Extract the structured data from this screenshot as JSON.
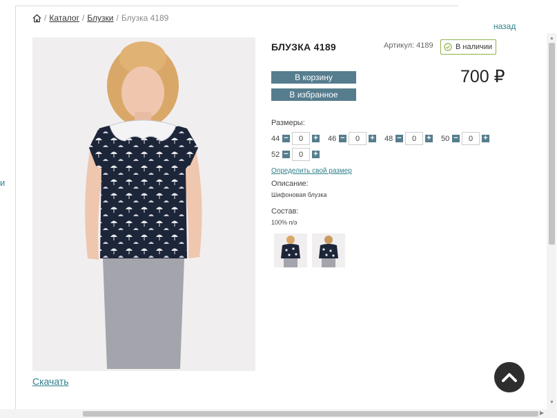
{
  "breadcrumb": {
    "sep": "/",
    "catalog": "Каталог",
    "category": "Блузки",
    "current": "Блузка 4189"
  },
  "edge_text": "и",
  "back_link": "назад",
  "product": {
    "title": "БЛУЗКА 4189",
    "sku": "Артикул: 4189",
    "stock": "В наличии",
    "price": "700 ₽",
    "add_to_cart": "В корзину",
    "add_to_favorites": "В избранное"
  },
  "sizes": {
    "label": "Размеры:",
    "items": [
      {
        "size": "44",
        "qty": "0"
      },
      {
        "size": "46",
        "qty": "0"
      },
      {
        "size": "48",
        "qty": "0"
      },
      {
        "size": "50",
        "qty": "0"
      },
      {
        "size": "52",
        "qty": "0"
      }
    ],
    "minus": "−",
    "plus": "+"
  },
  "size_link": "Определить свой размер",
  "description": {
    "label": "Описание:",
    "value": "Шифоновая блузка"
  },
  "composition": {
    "label": "Состав:",
    "value": "100% п/э"
  },
  "download_link": "Скачать",
  "colors": {
    "accent": "#567d8e",
    "link": "#2f7f8c",
    "stock_border": "#8bb24a"
  },
  "icons": [
    "home-icon",
    "check-circle-icon",
    "chevron-up-icon"
  ]
}
